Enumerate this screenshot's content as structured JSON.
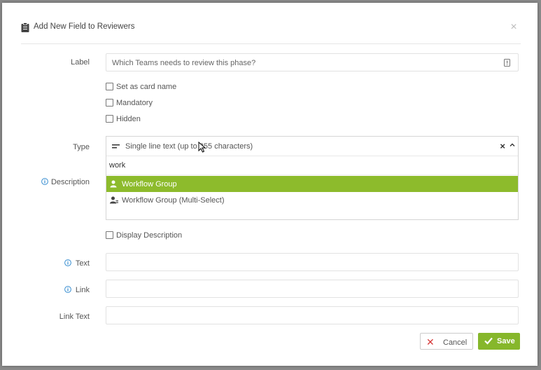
{
  "dialog": {
    "title": "Add New Field to Reviewers",
    "close_label": "×"
  },
  "form": {
    "label_label": "Label",
    "label_value": "Which Teams needs to review this phase?",
    "checkbox_card_name": "Set as card name",
    "checkbox_mandatory": "Mandatory",
    "checkbox_hidden": "Hidden",
    "type_label": "Type",
    "description_label": "Description",
    "display_description": "Display Description",
    "text_label": "Text",
    "link_label": "Link",
    "link_text_label": "Link Text"
  },
  "type_dropdown": {
    "selected": "Single line text (up to 255 characters)",
    "search_value": "work",
    "clear_label": "×",
    "options": [
      {
        "label": "Workflow Group",
        "active": true
      },
      {
        "label": "Workflow Group (Multi-Select)",
        "active": false
      }
    ]
  },
  "buttons": {
    "cancel": "Cancel",
    "save": "Save"
  },
  "colors": {
    "accent_green": "#8dbb2c",
    "save_green": "#86b72b",
    "cancel_red": "#d63a3a",
    "info_blue": "#3a8fd1"
  }
}
